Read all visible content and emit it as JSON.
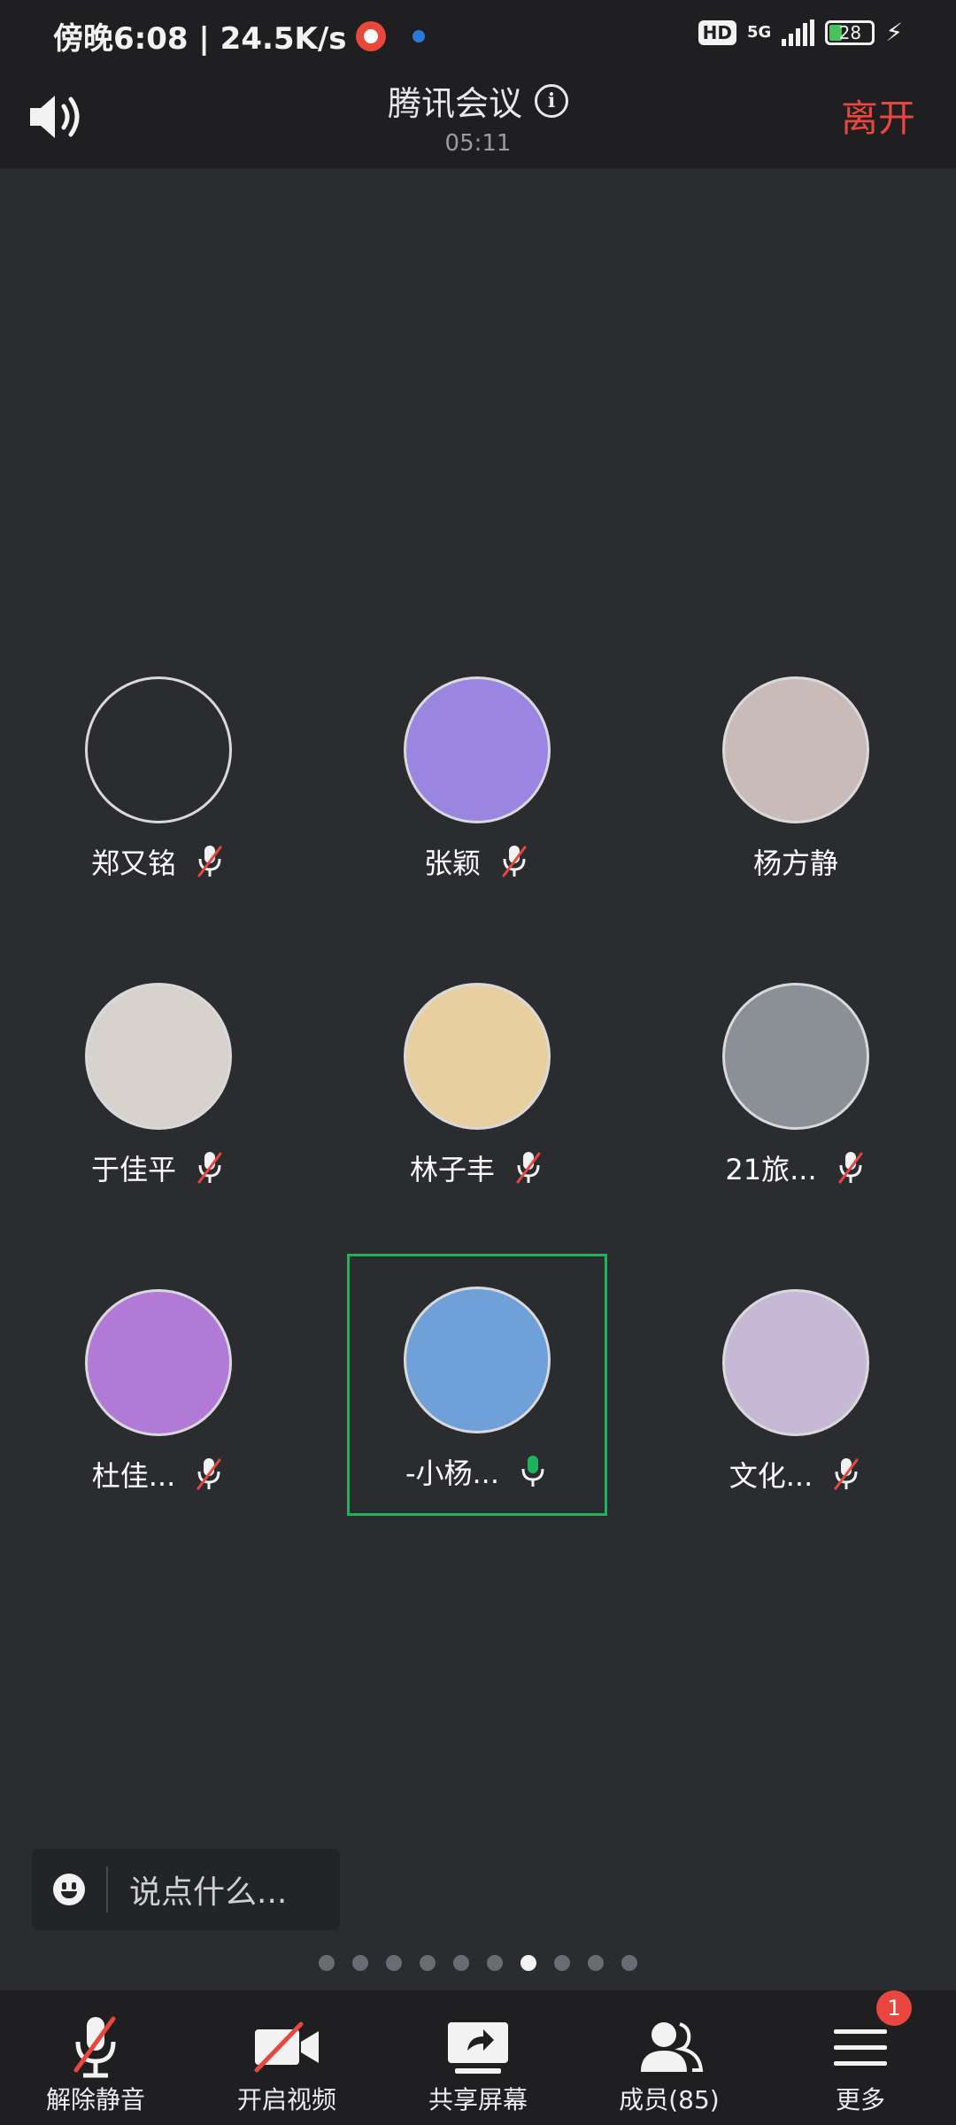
{
  "status_bar": {
    "time_speed": "傍晚6:08 | 24.5K/s",
    "hd": "HD",
    "network": "5G",
    "battery": "28"
  },
  "header": {
    "title": "腾讯会议",
    "timer": "05:11",
    "leave_label": "离开"
  },
  "participants": [
    {
      "name": "郑又铭",
      "muted": true,
      "avatar_color": "#2b2c30"
    },
    {
      "name": "张颖",
      "muted": true,
      "avatar_color": "#9a86e0"
    },
    {
      "name": "杨方静",
      "muted": null,
      "avatar_color": "#c9bcb8"
    },
    {
      "name": "于佳平",
      "muted": true,
      "avatar_color": "#d8d2cc"
    },
    {
      "name": "林子丰",
      "muted": true,
      "avatar_color": "#e8cfa0"
    },
    {
      "name": "21旅...",
      "muted": true,
      "avatar_color": "#8b8f96"
    },
    {
      "name": "杜佳...",
      "muted": true,
      "avatar_color": "#b07ad6"
    },
    {
      "name": "-小杨...",
      "muted": false,
      "speaking": true,
      "avatar_color": "#6fa0d8"
    },
    {
      "name": "文化...",
      "muted": true,
      "avatar_color": "#c7b9d6"
    }
  ],
  "chat": {
    "placeholder": "说点什么..."
  },
  "pagination": {
    "total": 10,
    "current": 7
  },
  "toolbar": {
    "unmute_label": "解除静音",
    "video_label": "开启视频",
    "share_label": "共享屏幕",
    "members_label": "成员(85)",
    "more_label": "更多",
    "more_badge": "1"
  },
  "colors": {
    "accent_red": "#e8463e",
    "active_green": "#1fb25c",
    "background": "#2b2c30"
  }
}
